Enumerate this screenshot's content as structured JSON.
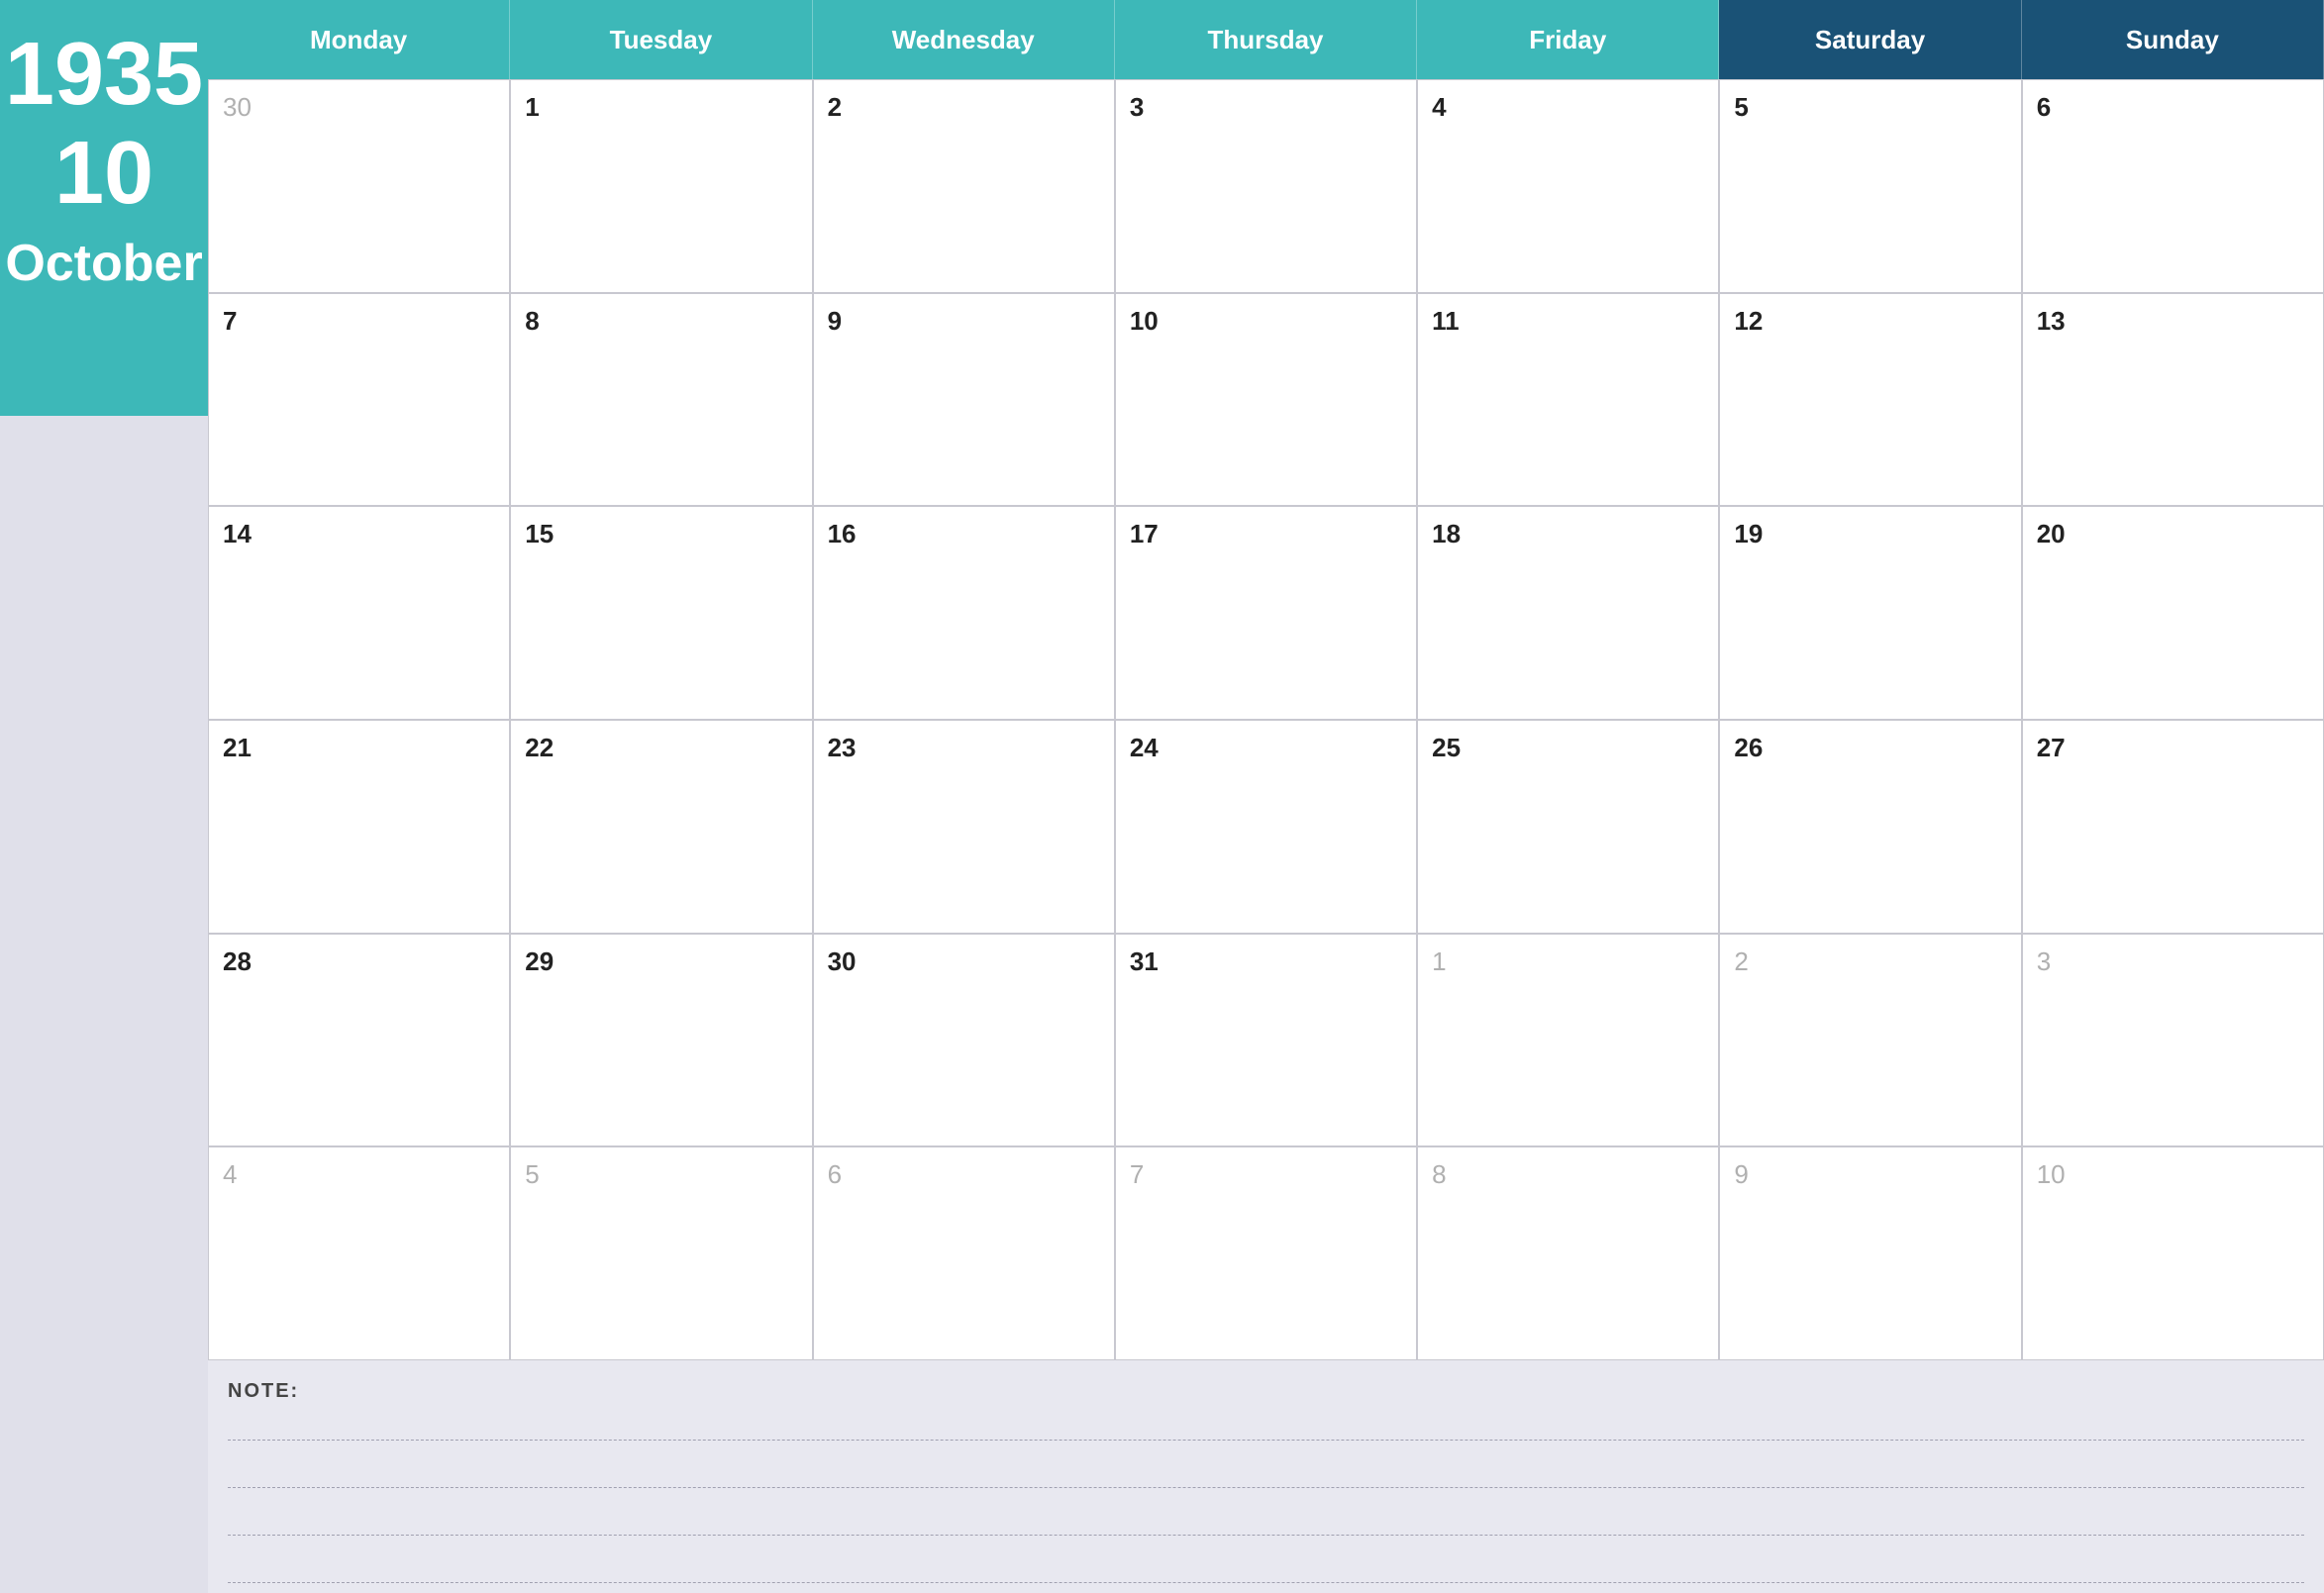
{
  "sidebar": {
    "year": "1935",
    "day_number": "10",
    "month": "October"
  },
  "header": {
    "days": [
      {
        "label": "Monday",
        "type": "weekday"
      },
      {
        "label": "Tuesday",
        "type": "weekday"
      },
      {
        "label": "Wednesday",
        "type": "weekday"
      },
      {
        "label": "Thursday",
        "type": "weekday"
      },
      {
        "label": "Friday",
        "type": "weekday"
      },
      {
        "label": "Saturday",
        "type": "weekend"
      },
      {
        "label": "Sunday",
        "type": "weekend"
      }
    ]
  },
  "calendar": {
    "weeks": [
      [
        {
          "date": "30",
          "muted": true
        },
        {
          "date": "1",
          "muted": false
        },
        {
          "date": "2",
          "muted": false
        },
        {
          "date": "3",
          "muted": false
        },
        {
          "date": "4",
          "muted": false
        },
        {
          "date": "5",
          "muted": false
        },
        {
          "date": "6",
          "muted": false
        }
      ],
      [
        {
          "date": "7",
          "muted": false
        },
        {
          "date": "8",
          "muted": false
        },
        {
          "date": "9",
          "muted": false
        },
        {
          "date": "10",
          "muted": false
        },
        {
          "date": "11",
          "muted": false
        },
        {
          "date": "12",
          "muted": false
        },
        {
          "date": "13",
          "muted": false
        }
      ],
      [
        {
          "date": "14",
          "muted": false
        },
        {
          "date": "15",
          "muted": false
        },
        {
          "date": "16",
          "muted": false
        },
        {
          "date": "17",
          "muted": false
        },
        {
          "date": "18",
          "muted": false
        },
        {
          "date": "19",
          "muted": false
        },
        {
          "date": "20",
          "muted": false
        }
      ],
      [
        {
          "date": "21",
          "muted": false
        },
        {
          "date": "22",
          "muted": false
        },
        {
          "date": "23",
          "muted": false
        },
        {
          "date": "24",
          "muted": false
        },
        {
          "date": "25",
          "muted": false
        },
        {
          "date": "26",
          "muted": false
        },
        {
          "date": "27",
          "muted": false
        }
      ],
      [
        {
          "date": "28",
          "muted": false
        },
        {
          "date": "29",
          "muted": false
        },
        {
          "date": "30",
          "muted": false
        },
        {
          "date": "31",
          "muted": false
        },
        {
          "date": "1",
          "muted": true
        },
        {
          "date": "2",
          "muted": true
        },
        {
          "date": "3",
          "muted": true
        }
      ],
      [
        {
          "date": "4",
          "muted": true
        },
        {
          "date": "5",
          "muted": true
        },
        {
          "date": "6",
          "muted": true
        },
        {
          "date": "7",
          "muted": true
        },
        {
          "date": "8",
          "muted": true
        },
        {
          "date": "9",
          "muted": true
        },
        {
          "date": "10",
          "muted": true
        }
      ]
    ]
  },
  "notes": {
    "label": "NOTE:",
    "line_count": 4
  }
}
